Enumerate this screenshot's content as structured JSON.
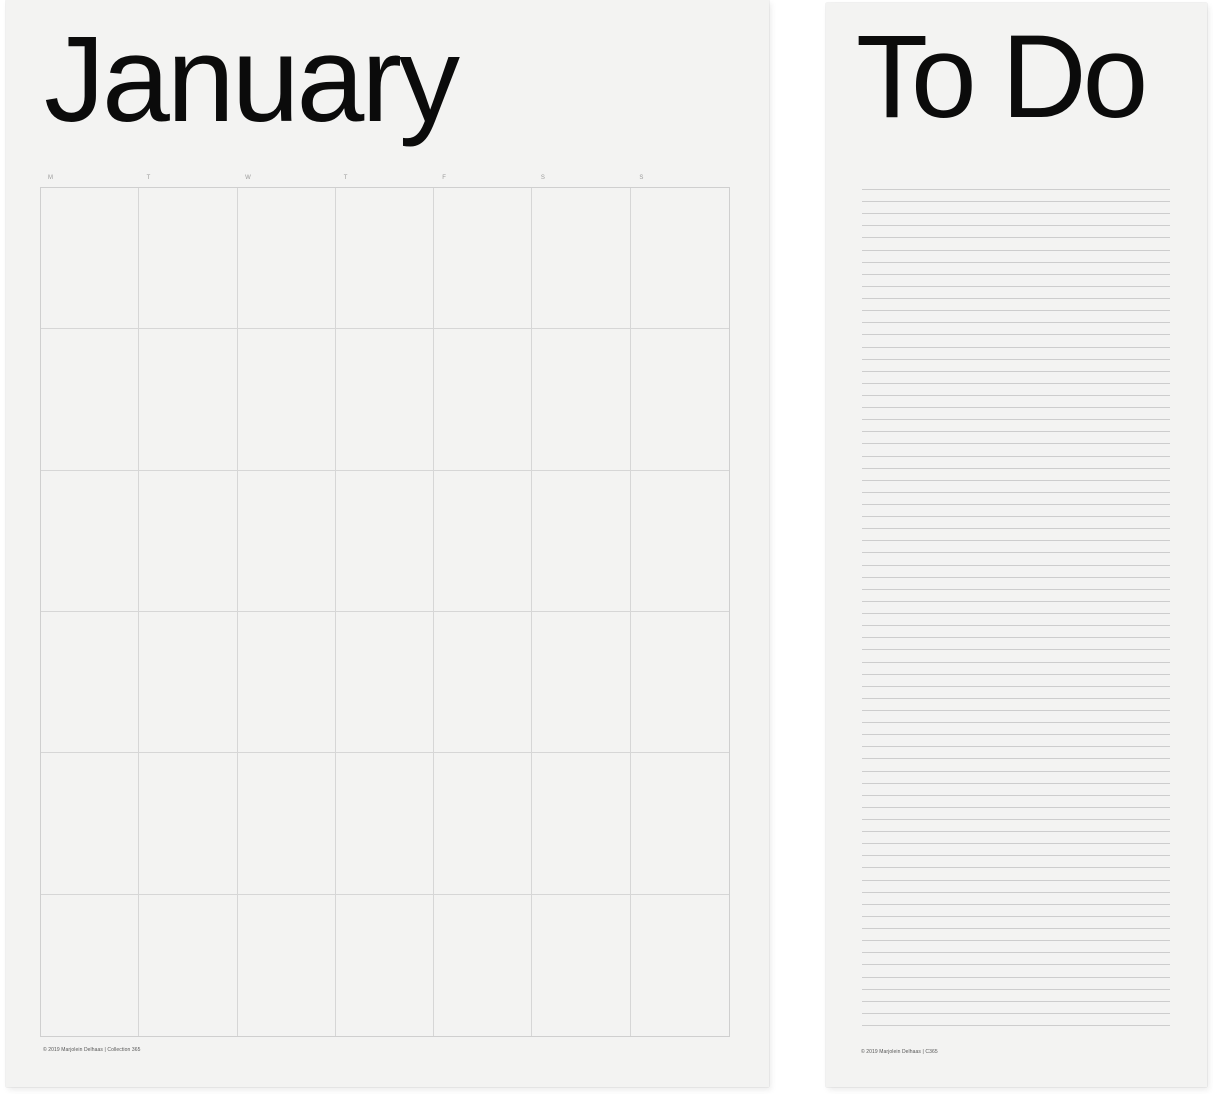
{
  "calendar": {
    "month_title": "January",
    "weekdays": [
      "M",
      "T",
      "W",
      "T",
      "F",
      "S",
      "S"
    ],
    "weeks": 6,
    "days_per_week": 7,
    "footer": "© 2019 Marjolein Delhaas | Collection 365"
  },
  "todo": {
    "title": "To Do",
    "line_count": 70,
    "footer": "© 2019 Marjolein Delhaas | C365"
  }
}
